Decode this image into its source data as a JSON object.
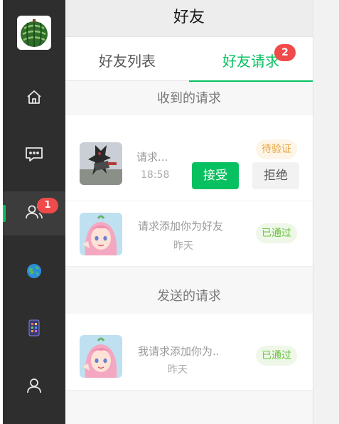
{
  "header": {
    "title": "好友"
  },
  "sidebar": {
    "badge_count": "1",
    "items": [
      {
        "name": "home"
      },
      {
        "name": "chat"
      },
      {
        "name": "contacts"
      },
      {
        "name": "globe"
      },
      {
        "name": "apps"
      },
      {
        "name": "profile"
      }
    ]
  },
  "tabs": [
    {
      "label": "好友列表",
      "active": false
    },
    {
      "label": "好友请求",
      "active": true,
      "badge": "2"
    }
  ],
  "received": {
    "title": "收到的请求",
    "items": [
      {
        "message": "请求...",
        "time": "18:58",
        "status": "待验证",
        "accept_label": "接受",
        "reject_label": "拒绝"
      },
      {
        "message": "请求添加你为好友",
        "time": "昨天",
        "status": "已通过"
      }
    ]
  },
  "sent": {
    "title": "发送的请求",
    "items": [
      {
        "message": "我请求添加你为..",
        "time": "昨天",
        "status": "已通过"
      }
    ]
  },
  "colors": {
    "accent": "#07c160",
    "badge": "#f04a4a",
    "pending": "#e6a23c",
    "passed": "#67c23a"
  }
}
